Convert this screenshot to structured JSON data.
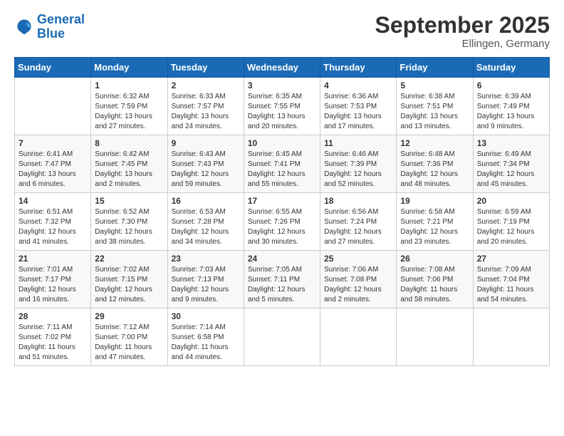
{
  "logo": {
    "line1": "General",
    "line2": "Blue"
  },
  "title": "September 2025",
  "location": "Ellingen, Germany",
  "days_header": [
    "Sunday",
    "Monday",
    "Tuesday",
    "Wednesday",
    "Thursday",
    "Friday",
    "Saturday"
  ],
  "weeks": [
    [
      {
        "day": "",
        "info": ""
      },
      {
        "day": "1",
        "info": "Sunrise: 6:32 AM\nSunset: 7:59 PM\nDaylight: 13 hours\nand 27 minutes."
      },
      {
        "day": "2",
        "info": "Sunrise: 6:33 AM\nSunset: 7:57 PM\nDaylight: 13 hours\nand 24 minutes."
      },
      {
        "day": "3",
        "info": "Sunrise: 6:35 AM\nSunset: 7:55 PM\nDaylight: 13 hours\nand 20 minutes."
      },
      {
        "day": "4",
        "info": "Sunrise: 6:36 AM\nSunset: 7:53 PM\nDaylight: 13 hours\nand 17 minutes."
      },
      {
        "day": "5",
        "info": "Sunrise: 6:38 AM\nSunset: 7:51 PM\nDaylight: 13 hours\nand 13 minutes."
      },
      {
        "day": "6",
        "info": "Sunrise: 6:39 AM\nSunset: 7:49 PM\nDaylight: 13 hours\nand 9 minutes."
      }
    ],
    [
      {
        "day": "7",
        "info": "Sunrise: 6:41 AM\nSunset: 7:47 PM\nDaylight: 13 hours\nand 6 minutes."
      },
      {
        "day": "8",
        "info": "Sunrise: 6:42 AM\nSunset: 7:45 PM\nDaylight: 13 hours\nand 2 minutes."
      },
      {
        "day": "9",
        "info": "Sunrise: 6:43 AM\nSunset: 7:43 PM\nDaylight: 12 hours\nand 59 minutes."
      },
      {
        "day": "10",
        "info": "Sunrise: 6:45 AM\nSunset: 7:41 PM\nDaylight: 12 hours\nand 55 minutes."
      },
      {
        "day": "11",
        "info": "Sunrise: 6:46 AM\nSunset: 7:39 PM\nDaylight: 12 hours\nand 52 minutes."
      },
      {
        "day": "12",
        "info": "Sunrise: 6:48 AM\nSunset: 7:36 PM\nDaylight: 12 hours\nand 48 minutes."
      },
      {
        "day": "13",
        "info": "Sunrise: 6:49 AM\nSunset: 7:34 PM\nDaylight: 12 hours\nand 45 minutes."
      }
    ],
    [
      {
        "day": "14",
        "info": "Sunrise: 6:51 AM\nSunset: 7:32 PM\nDaylight: 12 hours\nand 41 minutes."
      },
      {
        "day": "15",
        "info": "Sunrise: 6:52 AM\nSunset: 7:30 PM\nDaylight: 12 hours\nand 38 minutes."
      },
      {
        "day": "16",
        "info": "Sunrise: 6:53 AM\nSunset: 7:28 PM\nDaylight: 12 hours\nand 34 minutes."
      },
      {
        "day": "17",
        "info": "Sunrise: 6:55 AM\nSunset: 7:26 PM\nDaylight: 12 hours\nand 30 minutes."
      },
      {
        "day": "18",
        "info": "Sunrise: 6:56 AM\nSunset: 7:24 PM\nDaylight: 12 hours\nand 27 minutes."
      },
      {
        "day": "19",
        "info": "Sunrise: 6:58 AM\nSunset: 7:21 PM\nDaylight: 12 hours\nand 23 minutes."
      },
      {
        "day": "20",
        "info": "Sunrise: 6:59 AM\nSunset: 7:19 PM\nDaylight: 12 hours\nand 20 minutes."
      }
    ],
    [
      {
        "day": "21",
        "info": "Sunrise: 7:01 AM\nSunset: 7:17 PM\nDaylight: 12 hours\nand 16 minutes."
      },
      {
        "day": "22",
        "info": "Sunrise: 7:02 AM\nSunset: 7:15 PM\nDaylight: 12 hours\nand 12 minutes."
      },
      {
        "day": "23",
        "info": "Sunrise: 7:03 AM\nSunset: 7:13 PM\nDaylight: 12 hours\nand 9 minutes."
      },
      {
        "day": "24",
        "info": "Sunrise: 7:05 AM\nSunset: 7:11 PM\nDaylight: 12 hours\nand 5 minutes."
      },
      {
        "day": "25",
        "info": "Sunrise: 7:06 AM\nSunset: 7:08 PM\nDaylight: 12 hours\nand 2 minutes."
      },
      {
        "day": "26",
        "info": "Sunrise: 7:08 AM\nSunset: 7:06 PM\nDaylight: 11 hours\nand 58 minutes."
      },
      {
        "day": "27",
        "info": "Sunrise: 7:09 AM\nSunset: 7:04 PM\nDaylight: 11 hours\nand 54 minutes."
      }
    ],
    [
      {
        "day": "28",
        "info": "Sunrise: 7:11 AM\nSunset: 7:02 PM\nDaylight: 11 hours\nand 51 minutes."
      },
      {
        "day": "29",
        "info": "Sunrise: 7:12 AM\nSunset: 7:00 PM\nDaylight: 11 hours\nand 47 minutes."
      },
      {
        "day": "30",
        "info": "Sunrise: 7:14 AM\nSunset: 6:58 PM\nDaylight: 11 hours\nand 44 minutes."
      },
      {
        "day": "",
        "info": ""
      },
      {
        "day": "",
        "info": ""
      },
      {
        "day": "",
        "info": ""
      },
      {
        "day": "",
        "info": ""
      }
    ]
  ]
}
